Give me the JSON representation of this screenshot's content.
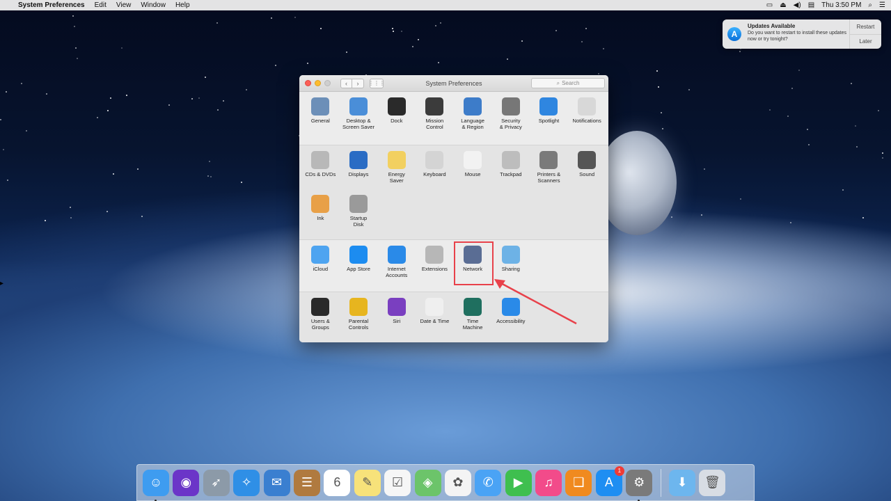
{
  "menubar": {
    "app_name": "System Preferences",
    "menus": [
      "Edit",
      "View",
      "Window",
      "Help"
    ],
    "clock": "Thu 3:50 PM"
  },
  "notification": {
    "title": "Updates Available",
    "body": "Do you want to restart to install these updates now or try tonight?",
    "restart_label": "Restart",
    "later_label": "Later"
  },
  "window": {
    "title": "System Preferences",
    "search_placeholder": "Search",
    "sections": [
      [
        {
          "label": "General",
          "icon": "general-icon",
          "color": "#6c8fb8"
        },
        {
          "label": "Desktop &\nScreen Saver",
          "icon": "desktop-icon",
          "color": "#4a8ed8"
        },
        {
          "label": "Dock",
          "icon": "dock-icon",
          "color": "#2a2a2a"
        },
        {
          "label": "Mission\nControl",
          "icon": "mission-control-icon",
          "color": "#3b3b3b"
        },
        {
          "label": "Language\n& Region",
          "icon": "language-icon",
          "color": "#3d7cc9"
        },
        {
          "label": "Security\n& Privacy",
          "icon": "security-icon",
          "color": "#777777"
        },
        {
          "label": "Spotlight",
          "icon": "spotlight-icon",
          "color": "#2f86e0"
        },
        {
          "label": "Notifications",
          "icon": "notifications-icon",
          "color": "#d8d8d8"
        }
      ],
      [
        {
          "label": "CDs & DVDs",
          "icon": "cd-icon",
          "color": "#b8b8b8"
        },
        {
          "label": "Displays",
          "icon": "displays-icon",
          "color": "#2a6cc4"
        },
        {
          "label": "Energy\nSaver",
          "icon": "energy-saver-icon",
          "color": "#f2d060"
        },
        {
          "label": "Keyboard",
          "icon": "keyboard-icon",
          "color": "#d4d4d4"
        },
        {
          "label": "Mouse",
          "icon": "mouse-icon",
          "color": "#f2f2f2"
        },
        {
          "label": "Trackpad",
          "icon": "trackpad-icon",
          "color": "#bdbdbd"
        },
        {
          "label": "Printers &\nScanners",
          "icon": "printer-icon",
          "color": "#7a7a7a"
        },
        {
          "label": "Sound",
          "icon": "sound-icon",
          "color": "#555555"
        },
        {
          "label": "Ink",
          "icon": "ink-icon",
          "color": "#e8a047"
        },
        {
          "label": "Startup\nDisk",
          "icon": "startup-disk-icon",
          "color": "#9a9a9a"
        }
      ],
      [
        {
          "label": "iCloud",
          "icon": "icloud-icon",
          "color": "#4ea4f0"
        },
        {
          "label": "App Store",
          "icon": "app-store-icon",
          "color": "#1c8cf0"
        },
        {
          "label": "Internet\nAccounts",
          "icon": "internet-accounts-icon",
          "color": "#2a8ae8"
        },
        {
          "label": "Extensions",
          "icon": "extensions-icon",
          "color": "#b7b7b7"
        },
        {
          "label": "Network",
          "icon": "network-icon",
          "color": "#5a6d94"
        },
        {
          "label": "Sharing",
          "icon": "sharing-icon",
          "color": "#6db2e6"
        }
      ],
      [
        {
          "label": "Users &\nGroups",
          "icon": "users-icon",
          "color": "#2a2a2a"
        },
        {
          "label": "Parental\nControls",
          "icon": "parental-controls-icon",
          "color": "#e7b51f"
        },
        {
          "label": "Siri",
          "icon": "siri-icon",
          "color": "#7a3fc0"
        },
        {
          "label": "Date & Time",
          "icon": "date-time-icon",
          "color": "#efefef"
        },
        {
          "label": "Time\nMachine",
          "icon": "time-machine-icon",
          "color": "#1f6f5f"
        },
        {
          "label": "Accessibility",
          "icon": "accessibility-icon",
          "color": "#2a8ae8"
        }
      ]
    ]
  },
  "dock": {
    "apps": [
      {
        "name": "finder-icon",
        "color": "#3e9cf0",
        "glyph": "☺",
        "running": true
      },
      {
        "name": "siri-icon",
        "color": "#6b35c8",
        "glyph": "◉",
        "running": false
      },
      {
        "name": "launchpad-icon",
        "color": "#8c9aa8",
        "glyph": "➶",
        "running": false
      },
      {
        "name": "safari-icon",
        "color": "#2f8fe6",
        "glyph": "✧",
        "running": false
      },
      {
        "name": "mail-icon",
        "color": "#3a7fd0",
        "glyph": "✉",
        "running": false
      },
      {
        "name": "contacts-icon",
        "color": "#b07a3f",
        "glyph": "☰",
        "running": false
      },
      {
        "name": "calendar-icon",
        "color": "#ffffff",
        "glyph": "6",
        "running": false
      },
      {
        "name": "notes-icon",
        "color": "#f7e27a",
        "glyph": "✎",
        "running": false
      },
      {
        "name": "reminders-icon",
        "color": "#f6f6f6",
        "glyph": "☑",
        "running": false
      },
      {
        "name": "maps-icon",
        "color": "#6cc46a",
        "glyph": "◈",
        "running": false
      },
      {
        "name": "photos-icon",
        "color": "#f4f4f4",
        "glyph": "✿",
        "running": false
      },
      {
        "name": "messages-icon",
        "color": "#4aa3f5",
        "glyph": "✆",
        "running": false
      },
      {
        "name": "facetime-icon",
        "color": "#3fbf4f",
        "glyph": "▶",
        "running": false
      },
      {
        "name": "itunes-icon",
        "color": "#f24b8a",
        "glyph": "♫",
        "running": false
      },
      {
        "name": "ibooks-icon",
        "color": "#f08a1f",
        "glyph": "❑",
        "running": false
      },
      {
        "name": "app-store-icon",
        "color": "#1e8ef2",
        "glyph": "A",
        "running": false,
        "badge": "1"
      },
      {
        "name": "system-preferences-icon",
        "color": "#7a7a7a",
        "glyph": "⚙",
        "running": true
      }
    ],
    "extras": [
      {
        "name": "downloads-folder-icon",
        "color": "#6db6ee",
        "glyph": "⬇"
      },
      {
        "name": "trash-icon",
        "color": "#d8dde4",
        "glyph": "🗑"
      }
    ]
  }
}
